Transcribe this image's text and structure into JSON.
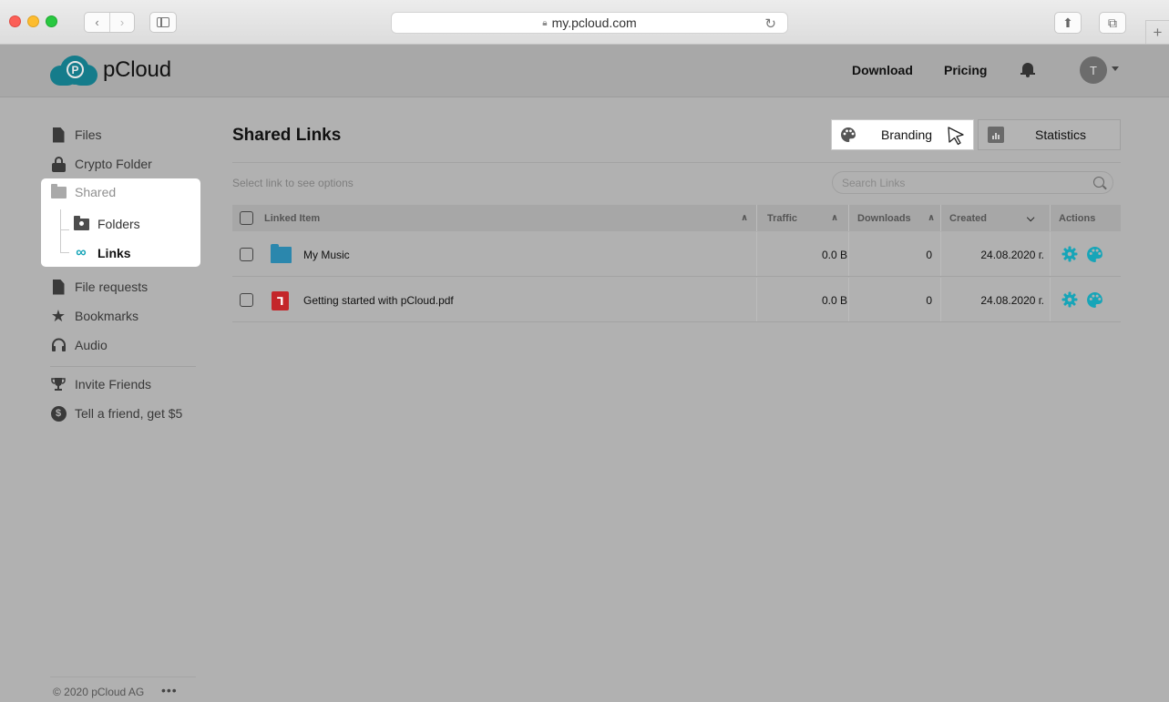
{
  "browser": {
    "url": "my.pcloud.com",
    "back_icon": "chevron-left-icon",
    "forward_icon": "chevron-right-icon"
  },
  "header": {
    "logo_text": "pCloud",
    "download": "Download",
    "pricing": "Pricing",
    "avatar_initial": "T"
  },
  "sidebar": {
    "files": "Files",
    "crypto": "Crypto Folder",
    "shared": "Shared",
    "folders": "Folders",
    "links": "Links",
    "file_requests": "File requests",
    "bookmarks": "Bookmarks",
    "audio": "Audio",
    "invite": "Invite Friends",
    "tell_friend": "Tell a friend, get $5",
    "footer": "© 2020 pCloud AG",
    "footer_more": "•••"
  },
  "main": {
    "title": "Shared Links",
    "branding": "Branding",
    "statistics": "Statistics",
    "select_hint": "Select link to see options",
    "search_placeholder": "Search Links",
    "columns": {
      "linked_item": "Linked Item",
      "traffic": "Traffic",
      "downloads": "Downloads",
      "created": "Created",
      "actions": "Actions"
    },
    "rows": [
      {
        "name": "My Music",
        "type": "folder",
        "traffic": "0.0 B",
        "downloads": "0",
        "created": "24.08.2020 г."
      },
      {
        "name": "Getting started with pCloud.pdf",
        "type": "pdf",
        "traffic": "0.0 B",
        "downloads": "0",
        "created": "24.08.2020 г."
      }
    ]
  },
  "colors": {
    "accent": "#17a5b8",
    "logo": "#157c8b",
    "pdf": "#c4262a",
    "folder": "#2b87ad"
  }
}
